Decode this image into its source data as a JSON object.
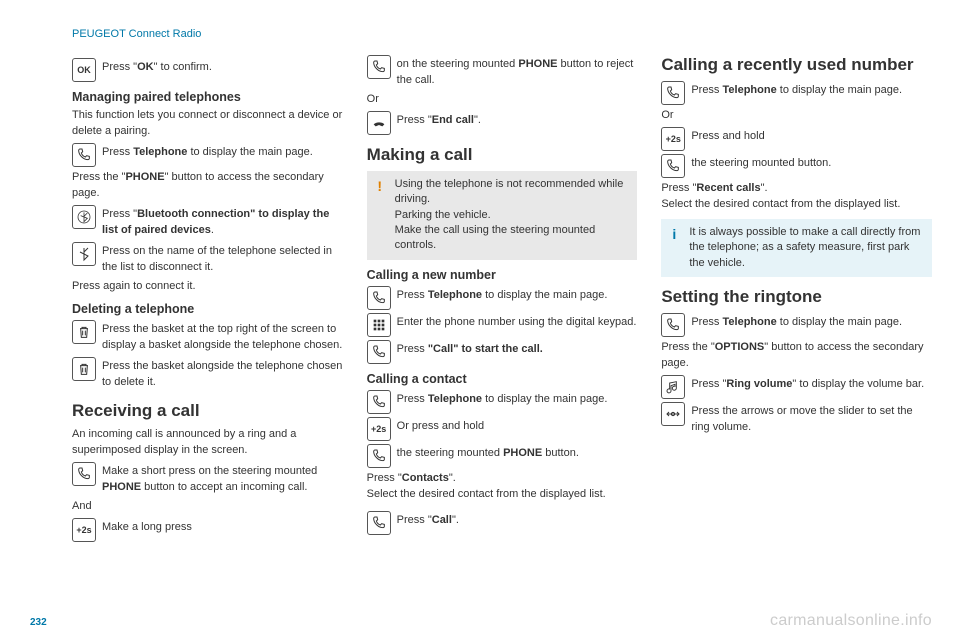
{
  "header": "PEUGEOT Connect Radio",
  "pageNumber": "232",
  "watermark": "carmanualsonline.info",
  "col1": {
    "okLine": {
      "pre": "Press \"",
      "bold": "OK",
      "post": "\" to confirm."
    },
    "managing": {
      "title": "Managing paired telephones",
      "intro": "This function lets you connect or disconnect a device or delete a pairing.",
      "telLine": {
        "pre": "Press ",
        "bold": "Telephone",
        "post": " to display the main page."
      },
      "pressPhone": {
        "pre": "Press the \"",
        "bold": "PHONE",
        "post": "\" button to access the secondary page."
      },
      "btLine": {
        "pre": "Press \"",
        "bold": "Bluetooth connection\" to display the list of paired devices",
        "post": "."
      },
      "selLine": "Press on the name of the telephone selected in the list to disconnect it.",
      "pressAgain": "Press again to connect it."
    },
    "deleting": {
      "title": "Deleting a telephone",
      "l1": "Press the basket at the top right of the screen to display a basket alongside the telephone chosen.",
      "l2": "Press the basket alongside the telephone chosen to delete it."
    },
    "receiving": {
      "title": "Receiving a call",
      "intro": "An incoming call is announced by a ring and a superimposed display in the screen.",
      "shortPress": {
        "pre": "Make a short press on the steering mounted ",
        "bold": "PHONE",
        "post": " button to accept an incoming call."
      },
      "and": "And",
      "longPress": "Make a long press"
    }
  },
  "col2": {
    "rejectLine": {
      "pre": "on the steering mounted ",
      "bold": "PHONE",
      "post": " button to reject the call."
    },
    "or": "Or",
    "endCall": {
      "pre": "Press \"",
      "bold": "End call",
      "post": "\"."
    },
    "making": {
      "title": "Making a call",
      "warn": "Using the telephone is not recommended while driving.\nParking the vehicle.\nMake the call using the steering mounted controls."
    },
    "newNum": {
      "title": "Calling a new number",
      "l1": {
        "pre": "Press ",
        "bold": "Telephone",
        "post": " to display the main page."
      },
      "l2": "Enter the phone number using the digital keypad.",
      "l3": {
        "pre": "Press ",
        "bold": "\"Call\" to start the call.",
        "post": ""
      }
    },
    "contact": {
      "title": "Calling a contact",
      "l1": {
        "pre": "Press ",
        "bold": "Telephone",
        "post": " to display the main page."
      },
      "l2": "Or press and hold",
      "l3": {
        "pre": "the steering mounted ",
        "bold": "PHONE",
        "post": " button."
      },
      "contacts": {
        "pre": "Press \"",
        "bold": "Contacts",
        "post": "\"."
      },
      "select": "Select the desired contact from the displayed list."
    }
  },
  "col3": {
    "callLine": {
      "pre": "Press \"",
      "bold": "Call",
      "post": "\"."
    },
    "recent": {
      "title": "Calling a recently used number",
      "l1": {
        "pre": "Press ",
        "bold": "Telephone",
        "post": " to display the main page."
      },
      "or": "Or",
      "l2": "Press and hold",
      "l3": "the steering mounted button.",
      "recentCalls": {
        "pre": "Press \"",
        "bold": "Recent calls",
        "post": "\"."
      },
      "select": "Select the desired contact from the displayed list.",
      "info": "It is always possible to make a call directly from the telephone; as a safety measure, first park the vehicle."
    },
    "ringtone": {
      "title": "Setting the ringtone",
      "l1": {
        "pre": "Press ",
        "bold": "Telephone",
        "post": " to display the main page."
      },
      "options": {
        "pre": "Press the \"",
        "bold": "OPTIONS",
        "post": "\" button to access the secondary page."
      },
      "l2": {
        "pre": "Press \"",
        "bold": "Ring volume",
        "post": "\" to display the volume bar."
      },
      "l3": "Press the arrows or move the slider to set the ring volume."
    }
  }
}
